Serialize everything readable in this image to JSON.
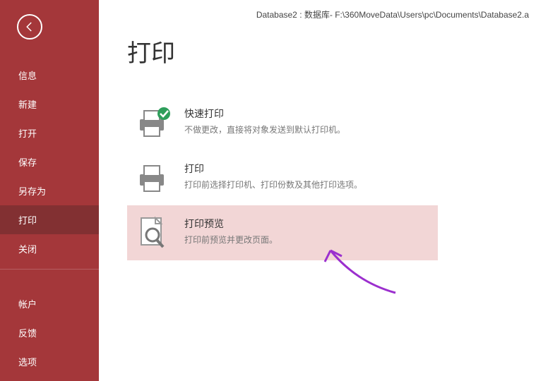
{
  "titlebar": "Database2 : 数据库- F:\\360MoveData\\Users\\pc\\Documents\\Database2.a",
  "page_title": "打印",
  "sidebar": {
    "items": [
      {
        "label": "信息"
      },
      {
        "label": "新建"
      },
      {
        "label": "打开"
      },
      {
        "label": "保存"
      },
      {
        "label": "另存为"
      },
      {
        "label": "打印"
      },
      {
        "label": "关闭"
      }
    ],
    "bottom": [
      {
        "label": "帐户"
      },
      {
        "label": "反馈"
      },
      {
        "label": "选项"
      }
    ]
  },
  "options": {
    "quick": {
      "title": "快速打印",
      "desc": "不做更改，直接将对象发送到默认打印机。"
    },
    "print": {
      "title": "打印",
      "desc": "打印前选择打印机、打印份数及其他打印选项。"
    },
    "preview": {
      "title": "打印预览",
      "desc": "打印前预览并更改页面。"
    }
  }
}
